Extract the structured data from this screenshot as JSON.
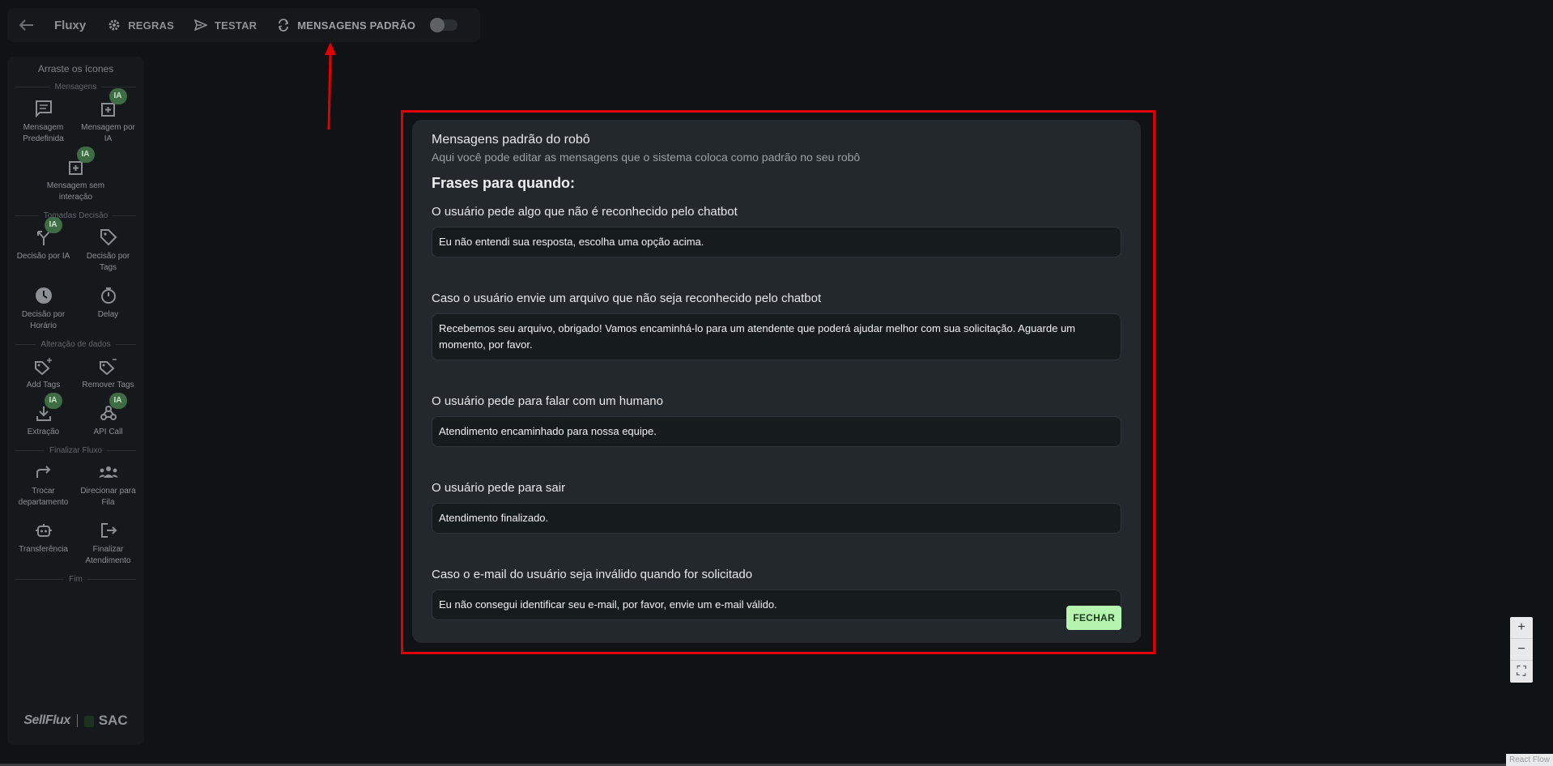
{
  "toolbar": {
    "title": "Fluxy",
    "items": [
      {
        "label": "REGRAS",
        "icon": "gear-icon"
      },
      {
        "label": "TESTAR",
        "icon": "send-icon"
      },
      {
        "label": "MENSAGENS PADRÃO",
        "icon": "refresh-icon"
      }
    ],
    "toggle_on": false
  },
  "sidebar": {
    "heading": "Arraste os ícones",
    "sections": [
      {
        "title": "Mensagens",
        "items": [
          {
            "label": "Mensagem Predefinida",
            "ia": false,
            "icon": "message-icon"
          },
          {
            "label": "Mensagem por IA",
            "ia": true,
            "icon": "ai-message-icon"
          },
          {
            "label": "Mensagem sem interação",
            "ia": true,
            "icon": "ai-message-icon"
          }
        ]
      },
      {
        "title": "Tomadas Decisão",
        "items": [
          {
            "label": "Decisão por IA",
            "ia": true,
            "icon": "fork-icon"
          },
          {
            "label": "Decisão por Tags",
            "ia": false,
            "icon": "tag-icon"
          },
          {
            "label": "Decisão por Horário",
            "ia": false,
            "icon": "clock-icon"
          },
          {
            "label": "Delay",
            "ia": false,
            "icon": "timer-icon"
          }
        ]
      },
      {
        "title": "Alteração de dados",
        "items": [
          {
            "label": "Add Tags",
            "ia": false,
            "icon": "tag-add-icon"
          },
          {
            "label": "Remover Tags",
            "ia": false,
            "icon": "tag-remove-icon"
          },
          {
            "label": "Extração",
            "ia": true,
            "icon": "download-icon"
          },
          {
            "label": "API Call",
            "ia": true,
            "icon": "webhook-icon"
          }
        ]
      },
      {
        "title": "Finalizar Fluxo",
        "items": [
          {
            "label": "Trocar departamento",
            "ia": false,
            "icon": "forward-icon"
          },
          {
            "label": "Direcionar para Fila",
            "ia": false,
            "icon": "group-icon"
          },
          {
            "label": "Transferência",
            "ia": false,
            "icon": "robot-icon"
          },
          {
            "label": "Finalizar Atendimento",
            "ia": false,
            "icon": "logout-icon"
          }
        ]
      }
    ],
    "end_label": "Fim",
    "ia_badge": "IA",
    "brand_left": "SellFlux",
    "brand_right": "SAC"
  },
  "modal": {
    "title": "Mensagens padrão do robô",
    "subtitle": "Aqui você pode editar as mensagens que o sistema coloca como padrão no seu robô",
    "section": "Frases para quando:",
    "fields": [
      {
        "label": "O usuário pede algo que não é reconhecido pelo chatbot",
        "value": "Eu não entendi sua resposta, escolha uma opção acima."
      },
      {
        "label": "Caso o usuário envie um arquivo que não seja reconhecido pelo chatbot",
        "value": "Recebemos seu arquivo, obrigado! Vamos encaminhá-lo para um atendente que poderá ajudar melhor com sua solicitação. Aguarde um momento, por favor."
      },
      {
        "label": "O usuário pede para falar com um humano",
        "value": "Atendimento encaminhado para nossa equipe."
      },
      {
        "label": "O usuário pede para sair",
        "value": "Atendimento finalizado."
      },
      {
        "label": "Caso o e-mail do usuário seja inválido quando for solicitado",
        "value": "Eu não consegui identificar seu e-mail, por favor, envie um e-mail válido."
      }
    ],
    "close_label": "FECHAR"
  },
  "zoom": {
    "in": "+",
    "out": "−",
    "fit": "⛶"
  },
  "attribution": "React Flow",
  "colors": {
    "highlight": "#e00000",
    "accent_button": "#b6f5b0",
    "ia_badge": "#3f6b45"
  }
}
